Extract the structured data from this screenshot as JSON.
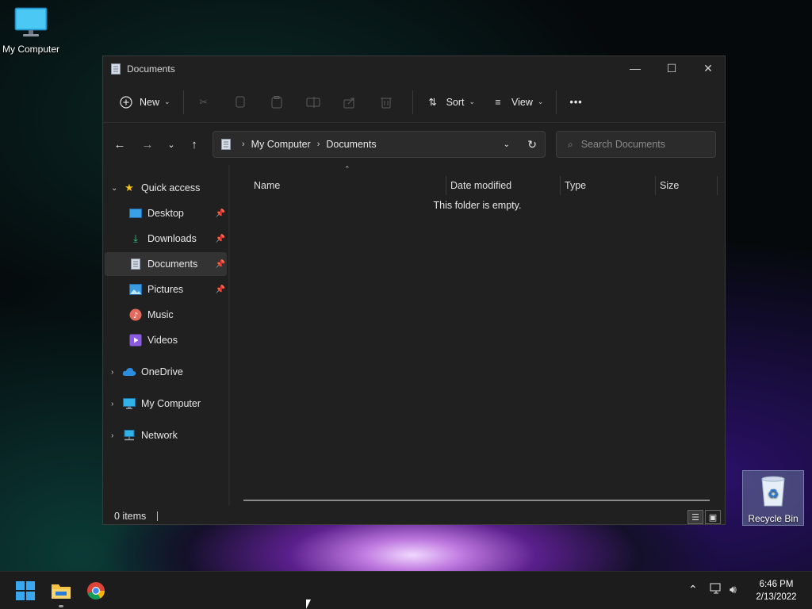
{
  "desktop": {
    "icons": [
      {
        "label": "My Computer",
        "icon": "monitor-icon"
      },
      {
        "label": "Recycle Bin",
        "icon": "recycle-bin-icon"
      }
    ]
  },
  "window": {
    "title": "Documents",
    "controls": {
      "minimize": "—",
      "maximize": "☐",
      "close": "✕"
    }
  },
  "command_bar": {
    "new_label": "New",
    "sort_label": "Sort",
    "view_label": "View",
    "more_label": "•••",
    "disabled_icons": [
      "cut-icon",
      "copy-icon",
      "paste-icon",
      "rename-icon",
      "share-icon",
      "delete-icon"
    ]
  },
  "address": {
    "crumbs": [
      "My Computer",
      "Documents"
    ],
    "search_placeholder": "Search Documents"
  },
  "sidebar": {
    "quick_access": "Quick access",
    "items": [
      {
        "label": "Desktop",
        "pinned": true,
        "color": "#3aa0e8"
      },
      {
        "label": "Downloads",
        "pinned": true,
        "color": "#3ccf8a"
      },
      {
        "label": "Documents",
        "pinned": true,
        "selected": true,
        "color": "#c9cfd8"
      },
      {
        "label": "Pictures",
        "pinned": true,
        "color": "#3a9be0"
      },
      {
        "label": "Music",
        "pinned": false,
        "color": "#e46a5c"
      },
      {
        "label": "Videos",
        "pinned": false,
        "color": "#8a5ae0"
      }
    ],
    "roots": [
      {
        "label": "OneDrive",
        "icon": "cloud-icon"
      },
      {
        "label": "My Computer",
        "icon": "monitor-icon"
      },
      {
        "label": "Network",
        "icon": "network-icon"
      }
    ]
  },
  "columns": {
    "name": "Name",
    "date_modified": "Date modified",
    "type": "Type",
    "size": "Size"
  },
  "content": {
    "empty_message": "This folder is empty."
  },
  "status": {
    "item_count": "0 items"
  },
  "taskbar": {
    "clock_time": "6:46 PM",
    "clock_date": "2/13/2022"
  }
}
